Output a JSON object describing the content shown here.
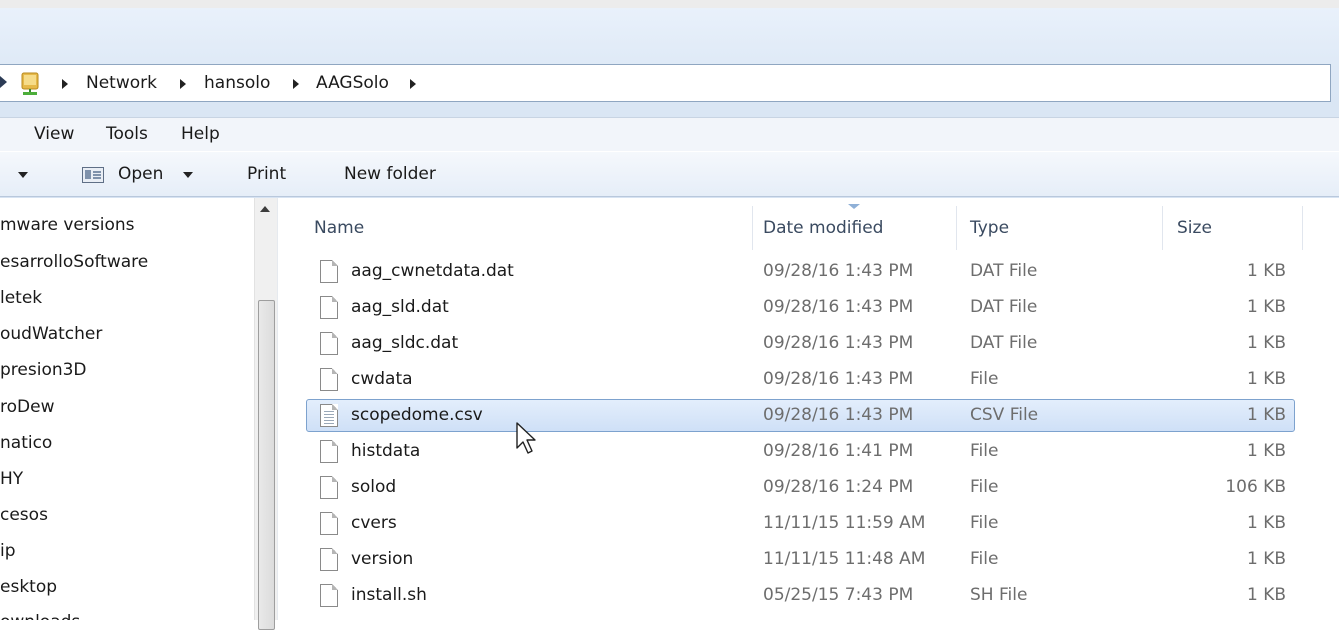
{
  "breadcrumb": [
    "Network",
    "hansolo",
    "AAGSolo"
  ],
  "menu": [
    "View",
    "Tools",
    "Help"
  ],
  "toolbar": {
    "open_label": "Open",
    "print_label": "Print",
    "new_folder_label": "New folder"
  },
  "nav_items": [
    "mware versions",
    "esarrolloSoftware",
    "letek",
    "oudWatcher",
    "presion3D",
    "roDew",
    "natico",
    "HY",
    "cesos",
    "ip",
    "esktop",
    "ownloads"
  ],
  "columns": {
    "name": "Name",
    "date": "Date modified",
    "type": "Type",
    "size": "Size"
  },
  "files": [
    {
      "name": "aag_cwnetdata.dat",
      "date": "09/28/16 1:43 PM",
      "type": "DAT File",
      "size": "1 KB",
      "selected": false,
      "icon": "blank-file-icon"
    },
    {
      "name": "aag_sld.dat",
      "date": "09/28/16 1:43 PM",
      "type": "DAT File",
      "size": "1 KB",
      "selected": false,
      "icon": "blank-file-icon"
    },
    {
      "name": "aag_sldc.dat",
      "date": "09/28/16 1:43 PM",
      "type": "DAT File",
      "size": "1 KB",
      "selected": false,
      "icon": "blank-file-icon"
    },
    {
      "name": "cwdata",
      "date": "09/28/16 1:43 PM",
      "type": "File",
      "size": "1 KB",
      "selected": false,
      "icon": "blank-file-icon"
    },
    {
      "name": "scopedome.csv",
      "date": "09/28/16 1:43 PM",
      "type": "CSV File",
      "size": "1 KB",
      "selected": true,
      "icon": "text-file-icon"
    },
    {
      "name": "histdata",
      "date": "09/28/16 1:41 PM",
      "type": "File",
      "size": "1 KB",
      "selected": false,
      "icon": "blank-file-icon"
    },
    {
      "name": "solod",
      "date": "09/28/16 1:24 PM",
      "type": "File",
      "size": "106 KB",
      "selected": false,
      "icon": "blank-file-icon"
    },
    {
      "name": "cvers",
      "date": "11/11/15 11:59 AM",
      "type": "File",
      "size": "1 KB",
      "selected": false,
      "icon": "blank-file-icon"
    },
    {
      "name": "version",
      "date": "11/11/15 11:48 AM",
      "type": "File",
      "size": "1 KB",
      "selected": false,
      "icon": "blank-file-icon"
    },
    {
      "name": "install.sh",
      "date": "05/25/15 7:43 PM",
      "type": "SH File",
      "size": "1 KB",
      "selected": false,
      "icon": "blank-file-icon"
    }
  ],
  "colors": {
    "selection_fill": "#cfe0f7",
    "selection_border": "#7da2ce",
    "chrome": "#dbe7f5"
  }
}
